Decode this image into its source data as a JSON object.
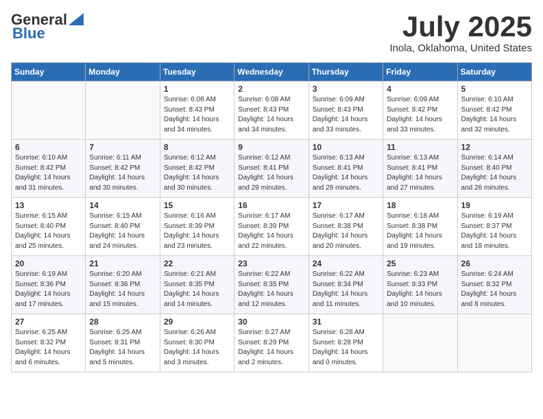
{
  "header": {
    "logo_general": "General",
    "logo_blue": "Blue",
    "month": "July 2025",
    "location": "Inola, Oklahoma, United States"
  },
  "days_of_week": [
    "Sunday",
    "Monday",
    "Tuesday",
    "Wednesday",
    "Thursday",
    "Friday",
    "Saturday"
  ],
  "weeks": [
    [
      {
        "day": "",
        "detail": ""
      },
      {
        "day": "",
        "detail": ""
      },
      {
        "day": "1",
        "detail": "Sunrise: 6:08 AM\nSunset: 8:43 PM\nDaylight: 14 hours\nand 34 minutes."
      },
      {
        "day": "2",
        "detail": "Sunrise: 6:08 AM\nSunset: 8:43 PM\nDaylight: 14 hours\nand 34 minutes."
      },
      {
        "day": "3",
        "detail": "Sunrise: 6:09 AM\nSunset: 8:43 PM\nDaylight: 14 hours\nand 33 minutes."
      },
      {
        "day": "4",
        "detail": "Sunrise: 6:09 AM\nSunset: 8:42 PM\nDaylight: 14 hours\nand 33 minutes."
      },
      {
        "day": "5",
        "detail": "Sunrise: 6:10 AM\nSunset: 8:42 PM\nDaylight: 14 hours\nand 32 minutes."
      }
    ],
    [
      {
        "day": "6",
        "detail": "Sunrise: 6:10 AM\nSunset: 8:42 PM\nDaylight: 14 hours\nand 31 minutes."
      },
      {
        "day": "7",
        "detail": "Sunrise: 6:11 AM\nSunset: 8:42 PM\nDaylight: 14 hours\nand 30 minutes."
      },
      {
        "day": "8",
        "detail": "Sunrise: 6:12 AM\nSunset: 8:42 PM\nDaylight: 14 hours\nand 30 minutes."
      },
      {
        "day": "9",
        "detail": "Sunrise: 6:12 AM\nSunset: 8:41 PM\nDaylight: 14 hours\nand 29 minutes."
      },
      {
        "day": "10",
        "detail": "Sunrise: 6:13 AM\nSunset: 8:41 PM\nDaylight: 14 hours\nand 28 minutes."
      },
      {
        "day": "11",
        "detail": "Sunrise: 6:13 AM\nSunset: 8:41 PM\nDaylight: 14 hours\nand 27 minutes."
      },
      {
        "day": "12",
        "detail": "Sunrise: 6:14 AM\nSunset: 8:40 PM\nDaylight: 14 hours\nand 26 minutes."
      }
    ],
    [
      {
        "day": "13",
        "detail": "Sunrise: 6:15 AM\nSunset: 8:40 PM\nDaylight: 14 hours\nand 25 minutes."
      },
      {
        "day": "14",
        "detail": "Sunrise: 6:15 AM\nSunset: 8:40 PM\nDaylight: 14 hours\nand 24 minutes."
      },
      {
        "day": "15",
        "detail": "Sunrise: 6:16 AM\nSunset: 8:39 PM\nDaylight: 14 hours\nand 23 minutes."
      },
      {
        "day": "16",
        "detail": "Sunrise: 6:17 AM\nSunset: 8:39 PM\nDaylight: 14 hours\nand 22 minutes."
      },
      {
        "day": "17",
        "detail": "Sunrise: 6:17 AM\nSunset: 8:38 PM\nDaylight: 14 hours\nand 20 minutes."
      },
      {
        "day": "18",
        "detail": "Sunrise: 6:18 AM\nSunset: 8:38 PM\nDaylight: 14 hours\nand 19 minutes."
      },
      {
        "day": "19",
        "detail": "Sunrise: 6:19 AM\nSunset: 8:37 PM\nDaylight: 14 hours\nand 18 minutes."
      }
    ],
    [
      {
        "day": "20",
        "detail": "Sunrise: 6:19 AM\nSunset: 8:36 PM\nDaylight: 14 hours\nand 17 minutes."
      },
      {
        "day": "21",
        "detail": "Sunrise: 6:20 AM\nSunset: 8:36 PM\nDaylight: 14 hours\nand 15 minutes."
      },
      {
        "day": "22",
        "detail": "Sunrise: 6:21 AM\nSunset: 8:35 PM\nDaylight: 14 hours\nand 14 minutes."
      },
      {
        "day": "23",
        "detail": "Sunrise: 6:22 AM\nSunset: 8:35 PM\nDaylight: 14 hours\nand 12 minutes."
      },
      {
        "day": "24",
        "detail": "Sunrise: 6:22 AM\nSunset: 8:34 PM\nDaylight: 14 hours\nand 11 minutes."
      },
      {
        "day": "25",
        "detail": "Sunrise: 6:23 AM\nSunset: 8:33 PM\nDaylight: 14 hours\nand 10 minutes."
      },
      {
        "day": "26",
        "detail": "Sunrise: 6:24 AM\nSunset: 8:32 PM\nDaylight: 14 hours\nand 8 minutes."
      }
    ],
    [
      {
        "day": "27",
        "detail": "Sunrise: 6:25 AM\nSunset: 8:32 PM\nDaylight: 14 hours\nand 6 minutes."
      },
      {
        "day": "28",
        "detail": "Sunrise: 6:25 AM\nSunset: 8:31 PM\nDaylight: 14 hours\nand 5 minutes."
      },
      {
        "day": "29",
        "detail": "Sunrise: 6:26 AM\nSunset: 8:30 PM\nDaylight: 14 hours\nand 3 minutes."
      },
      {
        "day": "30",
        "detail": "Sunrise: 6:27 AM\nSunset: 8:29 PM\nDaylight: 14 hours\nand 2 minutes."
      },
      {
        "day": "31",
        "detail": "Sunrise: 6:28 AM\nSunset: 8:28 PM\nDaylight: 14 hours\nand 0 minutes."
      },
      {
        "day": "",
        "detail": ""
      },
      {
        "day": "",
        "detail": ""
      }
    ]
  ]
}
